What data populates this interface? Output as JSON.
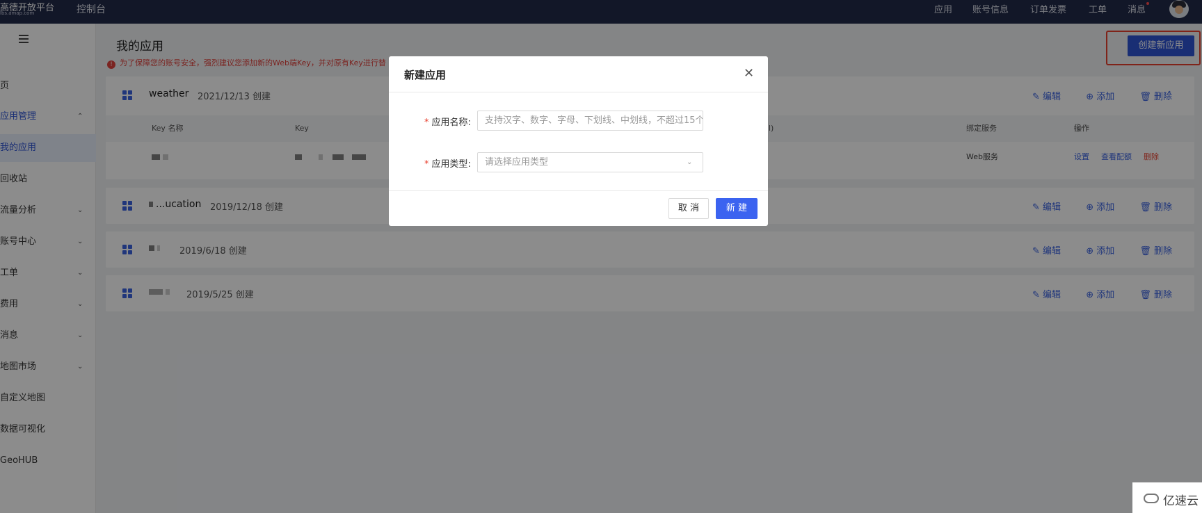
{
  "topbar": {
    "logo_line1": "高德开放平台",
    "logo_line2": "lbs.amap.com",
    "console": "控制台",
    "nav": [
      "应用",
      "账号信息",
      "订单发票",
      "工单",
      "消息"
    ]
  },
  "sidebar": {
    "items": [
      {
        "label": "页",
        "chevron": ""
      },
      {
        "label": "应用管理",
        "chevron": "⌃"
      },
      {
        "label": "我的应用",
        "chevron": ""
      },
      {
        "label": "回收站",
        "chevron": ""
      },
      {
        "label": "流量分析",
        "chevron": "⌄"
      },
      {
        "label": "账号中心",
        "chevron": "⌄"
      },
      {
        "label": "工单",
        "chevron": "⌄"
      },
      {
        "label": "费用",
        "chevron": "⌄"
      },
      {
        "label": "消息",
        "chevron": "⌄"
      },
      {
        "label": "地图市场",
        "chevron": "⌄"
      },
      {
        "label": "自定义地图",
        "chevron": ""
      },
      {
        "label": "数据可视化",
        "chevron": ""
      },
      {
        "label": "GeoHUB",
        "chevron": ""
      }
    ]
  },
  "main": {
    "title": "我的应用",
    "warning": "为了保障您的账号安全，强烈建议您添加新的Web端Key，并对原有Key进行替",
    "create_button": "创建新应用",
    "action_edit": "编辑",
    "action_add": "添加",
    "action_delete": "删除",
    "apps": [
      {
        "name": "weather",
        "date": "2021/12/13 创建"
      },
      {
        "name": "...ucation",
        "date": "2019/12/18 创建"
      },
      {
        "name": "",
        "date": "2019/6/18 创建"
      },
      {
        "name": "",
        "date": "2019/5/25 创建"
      }
    ],
    "table": {
      "headers": {
        "key_name": "Key 名称",
        "key": "Key",
        "partial": "l)",
        "service": "绑定服务",
        "ops": "操作"
      },
      "row": {
        "service": "Web服务",
        "op_settings": "设置",
        "op_config": "查看配额",
        "op_delete": "删除"
      }
    }
  },
  "modal": {
    "title": "新建应用",
    "name_label": "应用名称:",
    "name_placeholder": "支持汉字、数字、字母、下划线、中划线，不超过15个",
    "type_label": "应用类型:",
    "type_placeholder": "请选择应用类型",
    "required_mark": "*",
    "cancel": "取 消",
    "confirm": "新 建"
  },
  "watermark": {
    "text": "亿速云"
  },
  "colors": {
    "topbar": "#222a4a",
    "accent": "#2f55d4",
    "danger": "#e8402f"
  }
}
